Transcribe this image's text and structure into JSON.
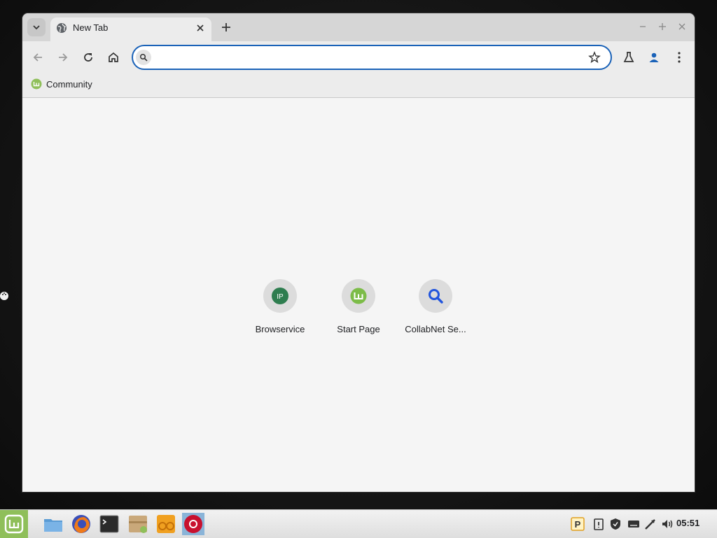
{
  "browser": {
    "tab": {
      "title": "New Tab"
    },
    "omnibox": {
      "value": "",
      "placeholder": ""
    },
    "bookmarks": [
      {
        "label": "Community"
      }
    ],
    "shortcuts": [
      {
        "title": "Browservice",
        "icon_text": "IP",
        "icon_color": "#2e7d4f"
      },
      {
        "title": "Start Page",
        "icon_color": "#7cbc48"
      },
      {
        "title": "CollabNet Se...",
        "icon_color": "#2255dd"
      }
    ],
    "colors": {
      "accent": "#1a62b8",
      "omnibox_border": "#1a62b8",
      "mint_green": "#8fbf5a"
    }
  },
  "taskbar": {
    "clock": "05:51",
    "tray_p_label": "P",
    "launchers": [
      "file-manager-icon",
      "firefox-icon",
      "terminal-icon",
      "archive-manager-icon",
      "software-manager-icon",
      "browser-icon"
    ],
    "tray": [
      "p-indicator-icon",
      "clipboard-icon",
      "shield-icon",
      "keyboard-icon",
      "network-icon",
      "volume-icon"
    ]
  }
}
